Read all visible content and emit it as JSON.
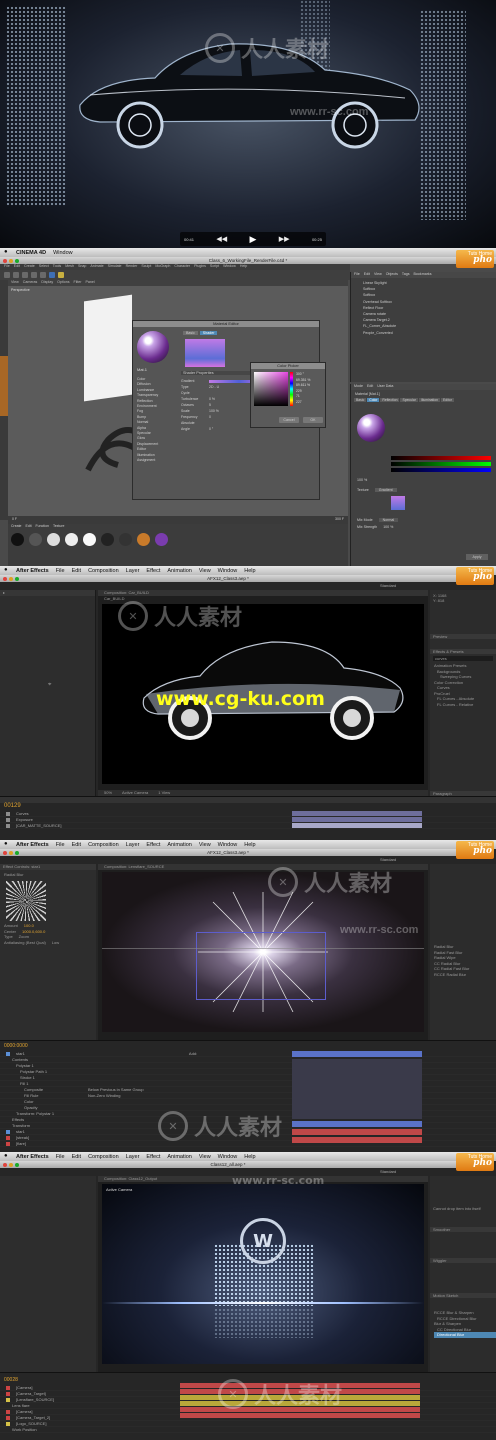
{
  "video": {
    "time_elapsed": "00:41",
    "time_remaining": "00:25"
  },
  "watermark": {
    "chinese": "人人素材",
    "url1": "www.rr-sc.com",
    "url2": "www.cg-ku.com"
  },
  "brand": {
    "line1": "Tuts Home",
    "line2": "pho"
  },
  "c4d": {
    "app_name": "CINEMA 4D",
    "menu_window": "Window",
    "window_title": "Class_6_WorkingFile_RenderFile.c4d *",
    "menu": [
      "File",
      "Edit",
      "Create",
      "Select",
      "Tools",
      "Mesh",
      "Snap",
      "Animate",
      "Simulate",
      "Render",
      "Sculpt",
      "MoGraph",
      "Character",
      "Plugins",
      "Script",
      "Window",
      "Help"
    ],
    "viewport_menu": [
      "View",
      "Cameras",
      "Display",
      "Options",
      "Filter",
      "Panel"
    ],
    "viewport_label": "Perspective",
    "material_editor": {
      "title": "Material Editor",
      "tabs": [
        "Basic",
        "Shader"
      ],
      "material_name": "Mat.1",
      "channels": [
        "Color",
        "Diffusion",
        "Luminance",
        "Transparency",
        "Reflection",
        "Environment",
        "Fog",
        "Bump",
        "Normal",
        "Alpha",
        "Specular",
        "Glow",
        "Displacement",
        "Editor",
        "Illumination",
        "Assignment"
      ],
      "section": "Shader Properties",
      "fields": [
        "Gradient",
        "Type",
        "Cycle",
        "Turbulence",
        "Octaves",
        "Scale",
        "Frequency",
        "Absolute",
        "Angle"
      ],
      "type_value": "2D - U",
      "turbulence_value": "0 %",
      "octaves_value": "5",
      "scale_value": "100 %",
      "frequency_value": "0",
      "angle_value": "0 °"
    },
    "color_picker": {
      "title": "Color Picker",
      "h": "300 °",
      "s": "69.351 %",
      "v": "89.611 %",
      "r": "229",
      "g": "71",
      "b": "227",
      "cancel": "Cancel",
      "ok": "OK"
    },
    "object_manager": {
      "menu": [
        "File",
        "Edit",
        "View",
        "Objects",
        "Tags",
        "Bookmarks"
      ],
      "objects": [
        "Linear Skylight",
        "Softbox",
        "Softbox",
        "Overhead Softbox",
        "Reflect Floor",
        "Camera rotate",
        "Camera Target.2",
        "FL_Corner_Absolute",
        "People_Converted"
      ]
    },
    "attributes": {
      "menu": [
        "Mode",
        "Edit",
        "User Data"
      ],
      "material_label": "Material [Mat.1]",
      "tabs": [
        "Basic",
        "Color",
        "Reflection",
        "Specular",
        "Illumination",
        "Editor"
      ],
      "brightness_value": "100 %",
      "texture_label": "Texture",
      "gradient_label": "Gradient",
      "mix_mode_label": "Mix Mode",
      "mix_mode_value": "Normal",
      "mix_strength_label": "Mix Strength",
      "mix_strength_value": "100 %"
    },
    "material_tabs": [
      "Create",
      "Edit",
      "Function",
      "Texture"
    ],
    "frame_value": "0 F",
    "end_frame": "300 F",
    "apply_label": "Apply"
  },
  "ae1": {
    "app_name": "After Effects",
    "menu": [
      "File",
      "Edit",
      "Composition",
      "Layer",
      "Effect",
      "Animation",
      "View",
      "Window",
      "Help"
    ],
    "window_title": "AFX12_Class3.aep *",
    "workspace": "Standard",
    "comp_tab": "Car_BUILD",
    "comp_name": "Composition: Car_BUILD",
    "timecode": "00129",
    "zoom": "50%",
    "camera": "Active Camera",
    "view": "1 View",
    "layers": [
      "Curves",
      "Exposure",
      "[CAR_MATTE_SOURCE]"
    ],
    "info_x": "X: 1168",
    "info_y": "Y: 818",
    "panels": [
      "Preview",
      "Effects & Presets",
      "Paragraph"
    ],
    "effects_search": "curves",
    "effects_items": [
      "Animation Presets",
      "Backgrounds",
      "Sweeping Curves",
      "Color Correction",
      "Curves",
      "ProCruel",
      "FL Curves - Absolute",
      "FL Curves - Relative"
    ]
  },
  "ae2": {
    "app_name": "After Effects",
    "menu": [
      "File",
      "Edit",
      "Composition",
      "Layer",
      "Effect",
      "Animation",
      "View",
      "Window",
      "Help"
    ],
    "window_title": "AFX12_Class3.aep *",
    "workspace": "Standard",
    "effect_controls": "Effect Controls: star1",
    "effect_name": "Radial Blur",
    "amount_label": "Amount",
    "amount_value": "100.0",
    "center_label": "Center",
    "center_value": "1000.0,600.0",
    "type_label": "Type",
    "type_value": "Zoom",
    "antialias_label": "Antialiasing (Best Qual)",
    "antialias_value": "Low",
    "comp_name": "Composition: Lensflare_SOURCE",
    "timecode": "0000:0000",
    "layers": [
      "star1",
      "Contents",
      "Polystar 1",
      "Polystar Path 1",
      "Stroke 1",
      "Fill 1",
      "Composite",
      "Fill Rule",
      "Color",
      "Opacity",
      "Transform: Polystar 1",
      "Effects",
      "Transform",
      "star1",
      "[streak]",
      "[flare]"
    ],
    "composite_value": "Below Previous in Same Group",
    "fill_rule_value": "Non-Zero Winding",
    "add_label": "Add:",
    "effects_items": [
      "Radial Blur",
      "Radial Fast Blur",
      "Radial Wipe",
      "CC Radial Blur",
      "CC Radial Fast Blur",
      "RCCE Radial Blur"
    ]
  },
  "ae3": {
    "app_name": "After Effects",
    "menu": [
      "File",
      "Edit",
      "Composition",
      "Layer",
      "Effect",
      "Animation",
      "View",
      "Window",
      "Help"
    ],
    "window_title": "Class12_all.aep *",
    "workspace": "Standard",
    "comp_name": "Composition: Class12_Output",
    "active_camera": "Active Camera",
    "timecode": "00028",
    "layers": [
      "[Camera]",
      "[Camera_Target]",
      "[Lensflare_SOURCE]",
      "Lens flare",
      "[Camera]",
      "[Camera_Target_2]",
      "[Logo_SOURCE]",
      "Work Position",
      "Opacity",
      "Position"
    ],
    "info_label": "Cannot drop item into itself",
    "panels": [
      "Smoother",
      "Wiggler",
      "Motion Sketch"
    ],
    "effects_items": [
      "RCCE Blur & Sharpen",
      "RCCE Directional Blur",
      "Blur & Sharpen",
      "CC Directional Blur",
      "Directional Blur"
    ]
  }
}
